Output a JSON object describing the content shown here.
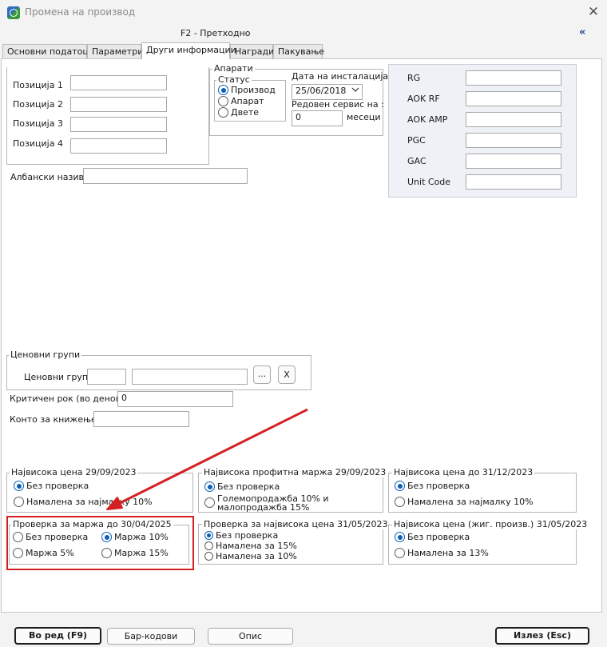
{
  "window": {
    "title": "Промена на производ",
    "mode": "F2 - Претходно",
    "collapse_glyph": "«",
    "close_glyph": "✕"
  },
  "tabs": [
    {
      "label": "Основни податоци"
    },
    {
      "label": "Параметри"
    },
    {
      "label": "Други информации"
    },
    {
      "label": "Награди"
    },
    {
      "label": "Пакување"
    }
  ],
  "active_tab": "Други информации",
  "positions": {
    "items": [
      {
        "label": "Позиција 1",
        "value": ""
      },
      {
        "label": "Позиција 2",
        "value": ""
      },
      {
        "label": "Позиција 3",
        "value": ""
      },
      {
        "label": "Позиција 4",
        "value": ""
      }
    ]
  },
  "albanian": {
    "label": "Албански назив",
    "value": ""
  },
  "devices": {
    "title": "Апарати",
    "status_title": "Статус",
    "status_options": [
      "Производ",
      "Апарат",
      "Двете"
    ],
    "status_selected": "Производ",
    "install_date_label": "Дата на инсталација",
    "install_date": "25/06/2018",
    "service_label": "Редовен сервис на :",
    "service_value": "0",
    "service_unit": "месеци"
  },
  "codes": [
    {
      "label": "RG",
      "value": ""
    },
    {
      "label": "AOK RF",
      "value": ""
    },
    {
      "label": "AOK AMP",
      "value": ""
    },
    {
      "label": "PGC",
      "value": ""
    },
    {
      "label": "GAC",
      "value": ""
    },
    {
      "label": "Unit Code",
      "value": ""
    }
  ],
  "price_groups": {
    "title": "Ценовни групи",
    "label": "Ценовни групи:",
    "code": "",
    "name": "",
    "browse_label": "...",
    "clear_label": "X"
  },
  "critical": {
    "label": "Критичен рок (во денови):",
    "value": "0"
  },
  "account": {
    "label": "Конто за книжење:",
    "value": ""
  },
  "checks": {
    "highest_price": {
      "title": "Највисока цена 29/09/2023",
      "options": [
        "Без проверка",
        "Намалена за најмалку 10%"
      ],
      "selected": "Без проверка"
    },
    "profit_margin": {
      "title": "Највисока профитна маржа 29/09/2023",
      "options": [
        "Без проверка",
        "Големопродажба 10% и малопродажба 15%"
      ],
      "selected": "Без проверка"
    },
    "highest_price_1231": {
      "title": "Највисока цена до 31/12/2023",
      "options": [
        "Без проверка",
        "Намалена за најмалку 10%"
      ],
      "selected": "Без проверка"
    },
    "margin_check": {
      "title": "Проверка за маржа до 30/04/2025",
      "options": [
        "Без проверка",
        "Маржа 10%",
        "Маржа 5%",
        "Маржа 15%"
      ],
      "selected": "Маржа 10%"
    },
    "highest_price_check": {
      "title": "Проверка за највисока цена 31/05/2023",
      "options": [
        "Без проверка",
        "Намалена за 15%",
        "Намалена за 10%"
      ],
      "selected": "Без проверка"
    },
    "staple_price": {
      "title": "Највисока цена (жиг. произв.) 31/05/2023",
      "options": [
        "Без проверка",
        "Намалена за 13%"
      ],
      "selected": "Без проверка"
    }
  },
  "footer": {
    "ok_label": "Во ред (F9)",
    "barcodes_label": "Бар-кодови",
    "description_label": "Опис",
    "exit_label": "Излез (Esc)"
  },
  "colors": {
    "accent": "#0a5fb4",
    "annotation": "#d42020"
  }
}
